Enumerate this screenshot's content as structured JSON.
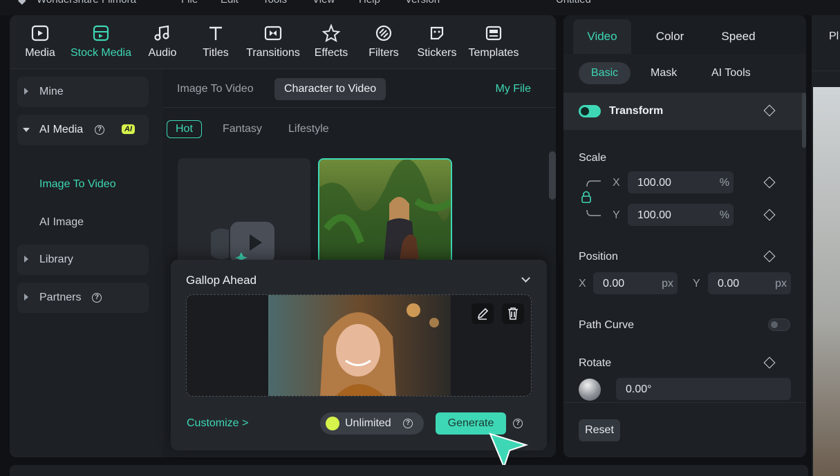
{
  "titlebar": {
    "app_name": "Wondershare Filmora",
    "menus": [
      "File",
      "Edit",
      "Tools",
      "View",
      "Help",
      "Version"
    ],
    "project": "Untitled"
  },
  "toolbar": {
    "items": [
      {
        "label": "Media",
        "icon": "media-icon"
      },
      {
        "label": "Stock Media",
        "icon": "stock-media-icon",
        "active": true
      },
      {
        "label": "Audio",
        "icon": "music-note-icon"
      },
      {
        "label": "Titles",
        "icon": "text-t-icon"
      },
      {
        "label": "Transitions",
        "icon": "transition-icon"
      },
      {
        "label": "Effects",
        "icon": "effects-star-icon"
      },
      {
        "label": "Filters",
        "icon": "filter-icon"
      },
      {
        "label": "Stickers",
        "icon": "sticker-icon"
      },
      {
        "label": "Templates",
        "icon": "template-icon"
      }
    ]
  },
  "sidebar": {
    "mine": "Mine",
    "ai_media": "AI Media",
    "ai_badge": "AI",
    "sub": [
      "Image To Video",
      "AI Image"
    ],
    "library": "Library",
    "partners": "Partners"
  },
  "content": {
    "tabs": [
      "Image To Video",
      "Character to Video"
    ],
    "active_tab": "Character to Video",
    "my_file": "My File",
    "chips": [
      "Hot",
      "Fantasy",
      "Lifestyle"
    ],
    "active_chip": "Hot"
  },
  "popup": {
    "title": "Gallop Ahead",
    "customize": "Customize >",
    "unlimited": "Unlimited",
    "generate": "Generate"
  },
  "inspector": {
    "tabs": [
      "Video",
      "Color",
      "Speed"
    ],
    "subtabs": [
      "Basic",
      "Mask",
      "AI Tools"
    ],
    "transform": "Transform",
    "scale": {
      "label": "Scale",
      "x_axis": "X",
      "y_axis": "Y",
      "x": "100.00",
      "y": "100.00",
      "unit": "%"
    },
    "position": {
      "label": "Position",
      "x_axis": "X",
      "y_axis": "Y",
      "x": "0.00",
      "y": "0.00",
      "unit": "px"
    },
    "path_curve": "Path Curve",
    "rotate": {
      "label": "Rotate",
      "value": "0.00°"
    },
    "reset": "Reset"
  },
  "player": {
    "label": "Pl"
  },
  "colors": {
    "accent": "#3ed7b5",
    "ai_badge": "#d6f34b",
    "panel": "#1d2024"
  }
}
